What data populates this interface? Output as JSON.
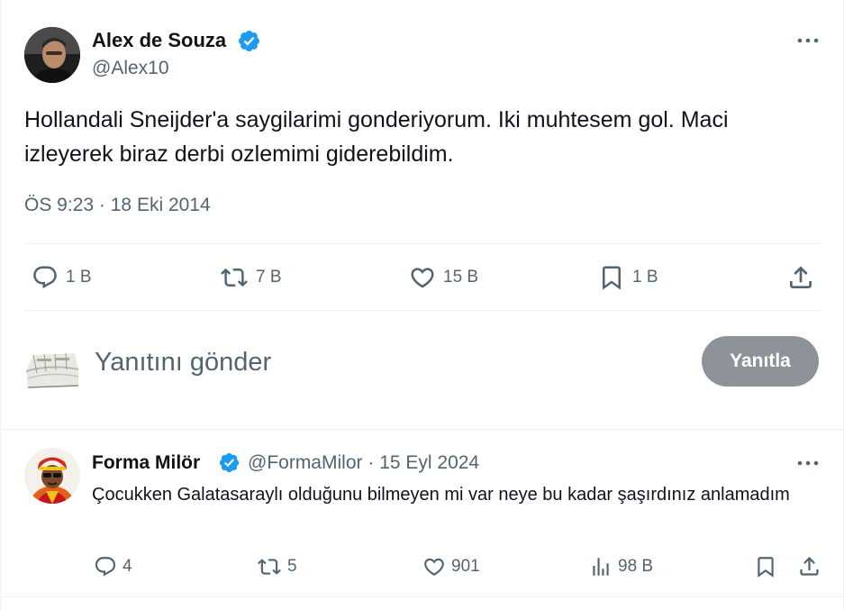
{
  "tweet": {
    "author_name": "Alex de Souza",
    "author_handle": "@Alex10",
    "text": "Hollandali Sneijder'a saygilarimi gonderiyorum. Iki muhtesem gol. Maci izleyerek biraz derbi ozlemimi giderebildim.",
    "time": "ÖS 9:23",
    "separator": "·",
    "date": "18 Eki 2014",
    "stats": {
      "replies": "1 B",
      "retweets": "7 B",
      "likes": "15 B",
      "bookmarks": "1 B"
    }
  },
  "composer": {
    "placeholder": "Yanıtını gönder",
    "button_label": "Yanıtla"
  },
  "reply": {
    "author_name": "Forma Milör",
    "author_handle": "@FormaMilor",
    "separator": "·",
    "date": "15 Eyl 2024",
    "text": "Çocukken Galatasaraylı olduğunu bilmeyen mi var neye bu kadar şaşırdınız anlamadım",
    "stats": {
      "replies": "4",
      "retweets": "5",
      "likes": "901",
      "views": "98 B"
    }
  },
  "colors": {
    "verified": "#1d9bf0",
    "muted_text": "#536471",
    "button_disabled": "#8d9399",
    "divider": "#eff3f4"
  },
  "icons": [
    "verified-badge-icon",
    "more-options-icon",
    "reply-icon",
    "retweet-icon",
    "like-icon",
    "bookmark-icon",
    "share-icon",
    "views-icon"
  ]
}
